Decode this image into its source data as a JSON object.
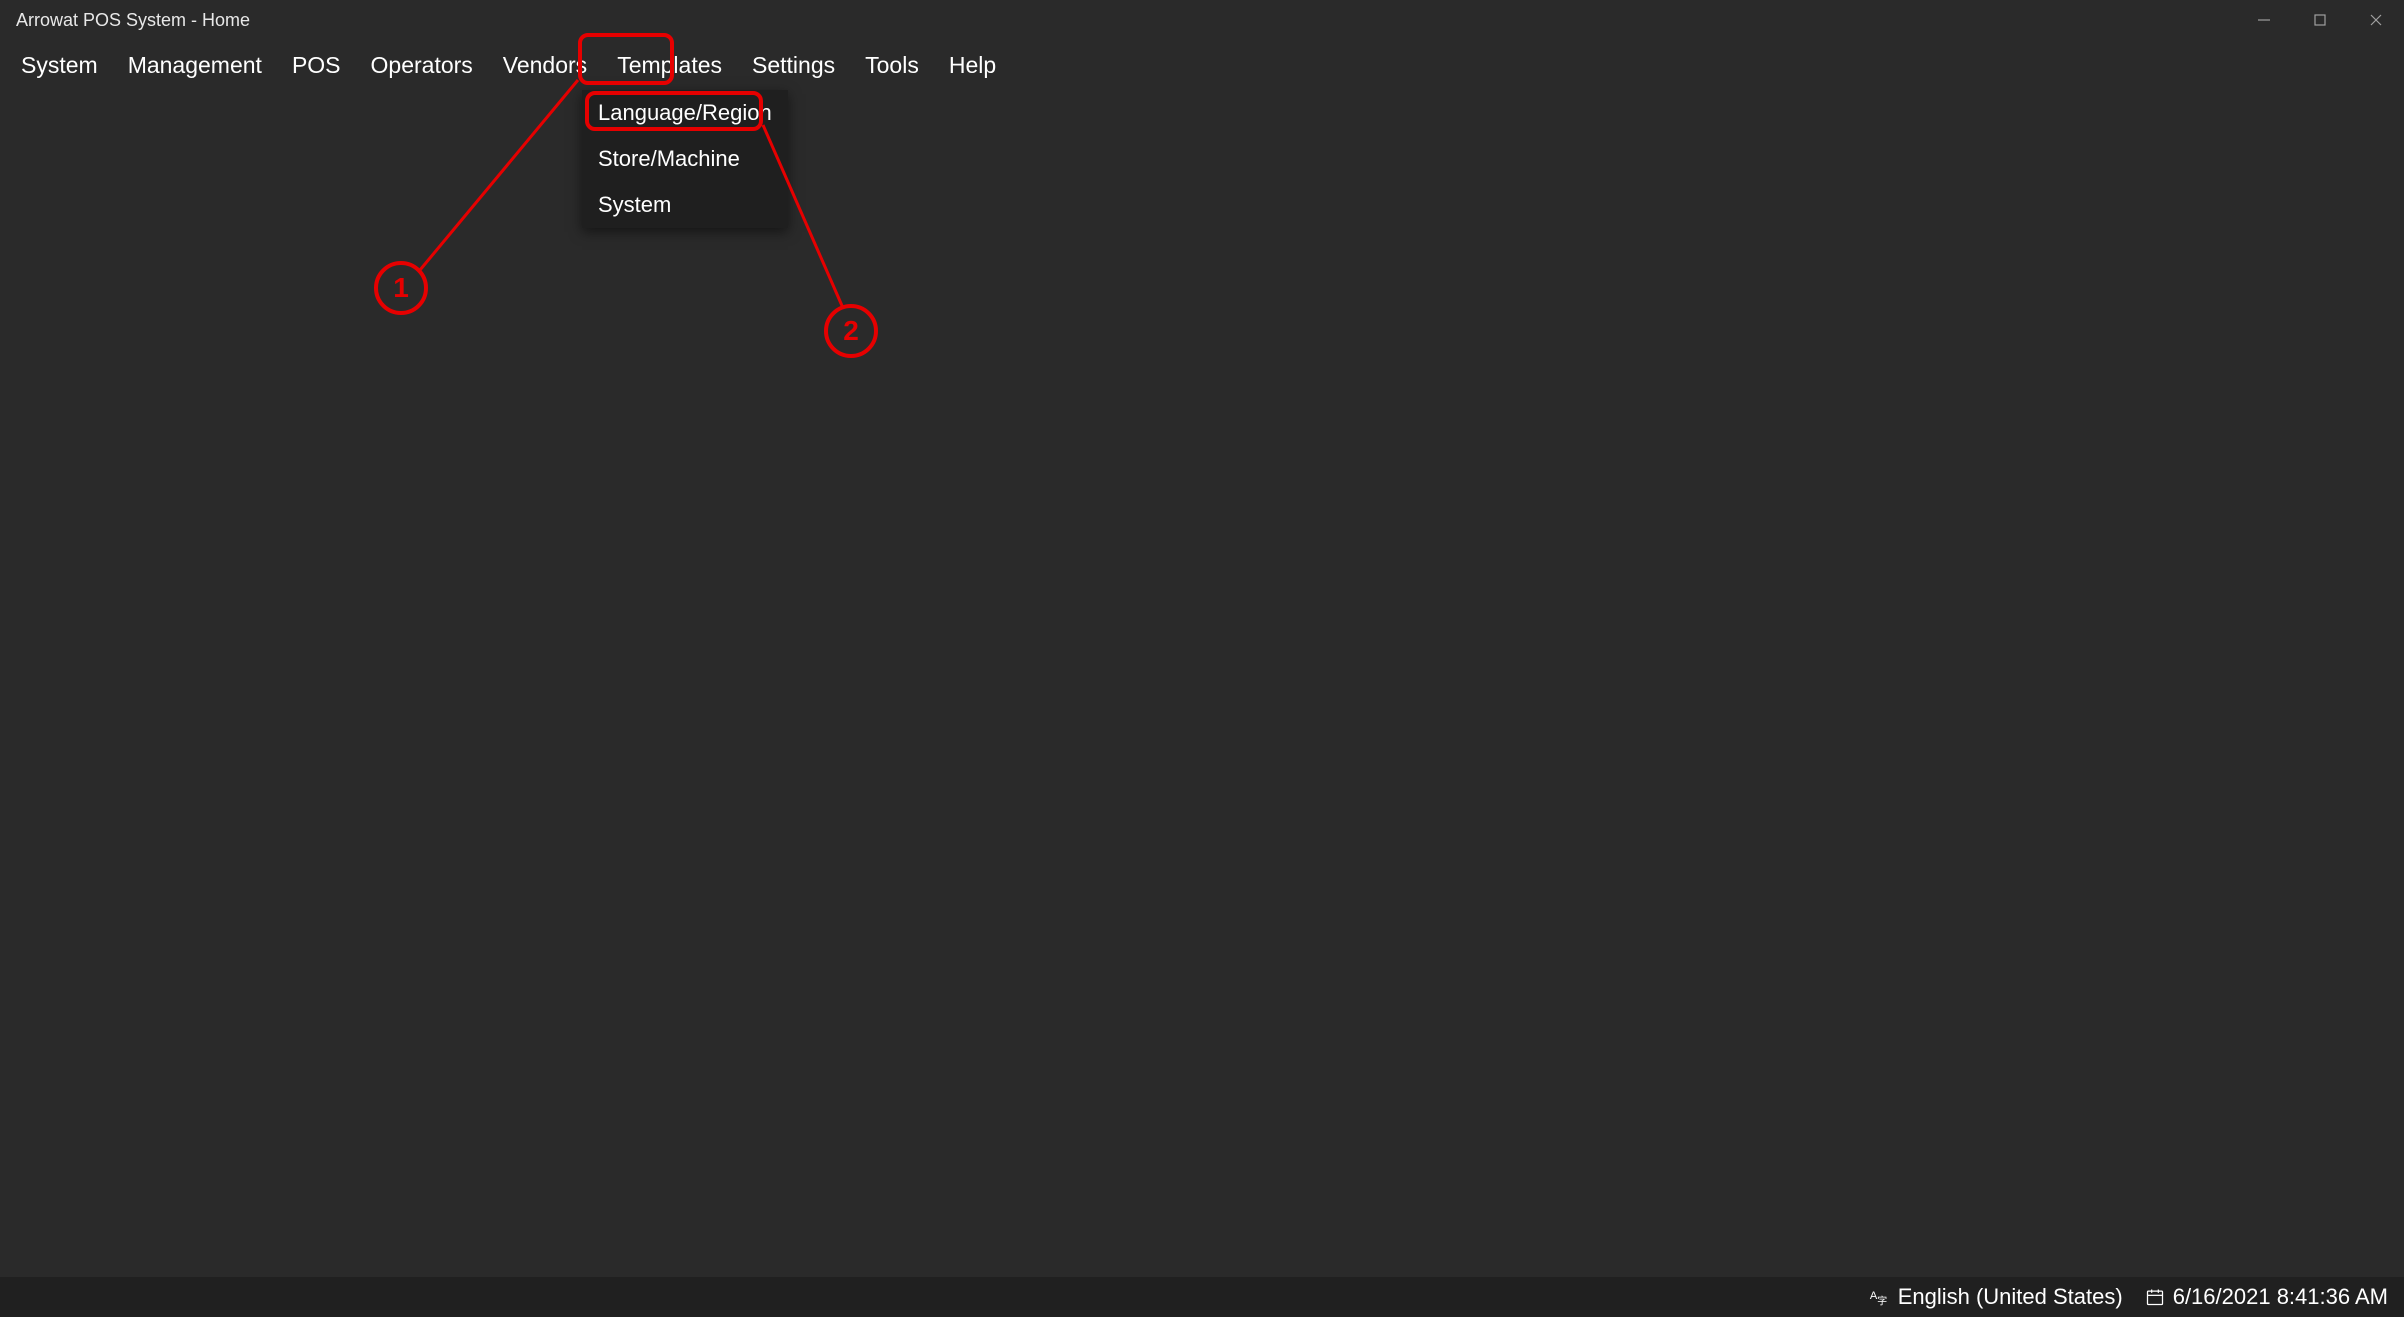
{
  "window": {
    "title": "Arrowat POS System - Home"
  },
  "menu": {
    "items": [
      {
        "label": "System"
      },
      {
        "label": "Management"
      },
      {
        "label": "POS"
      },
      {
        "label": "Operators"
      },
      {
        "label": "Vendors"
      },
      {
        "label": "Templates"
      },
      {
        "label": "Settings"
      },
      {
        "label": "Tools"
      },
      {
        "label": "Help"
      }
    ]
  },
  "dropdown": {
    "items": [
      {
        "label": "Language/Region"
      },
      {
        "label": "Store/Machine"
      },
      {
        "label": "System"
      }
    ]
  },
  "statusbar": {
    "language": "English (United States)",
    "datetime": "6/16/2021 8:41:36 AM"
  },
  "annotations": {
    "label1": "1",
    "label2": "2"
  }
}
